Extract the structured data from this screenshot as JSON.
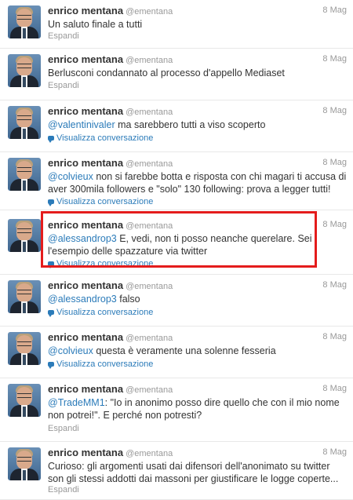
{
  "colors": {
    "mention": "#2b7bb9",
    "muted": "#999999",
    "highlight": "#e41c1c"
  },
  "tweets": [
    {
      "name": "enrico mentana",
      "handle": "@ementana",
      "date": "8 Mag",
      "mention": "",
      "text": "Un saluto finale a tutti",
      "action": "Espandi",
      "action_type": "expand"
    },
    {
      "name": "enrico mentana",
      "handle": "@ementana",
      "date": "8 Mag",
      "mention": "",
      "text": "Berlusconi   condannato al processo d'appello Mediaset",
      "action": "Espandi",
      "action_type": "expand"
    },
    {
      "name": "enrico mentana",
      "handle": "@ementana",
      "date": "8 Mag",
      "mention": "@valentinivaler",
      "text": " ma sarebbero tutti a viso scoperto",
      "action": "Visualizza conversazione",
      "action_type": "conversation"
    },
    {
      "name": "enrico mentana",
      "handle": "@ementana",
      "date": "8 Mag",
      "mention": "@colvieux",
      "text": " non si farebbe botta e risposta con chi magari ti accusa di aver 300mila followers e \"solo\" 130 following: prova a legger tutti!",
      "action": "Visualizza conversazione",
      "action_type": "conversation"
    },
    {
      "name": "enrico mentana",
      "handle": "@ementana",
      "date": "8 Mag",
      "mention": "@alessandrop3",
      "text": " E, vedi, non ti posso neanche querelare. Sei l'esempio delle spazzature via twitter",
      "action": "Visualizza conversazione",
      "action_type": "conversation"
    },
    {
      "name": "enrico mentana",
      "handle": "@ementana",
      "date": "8 Mag",
      "mention": "@alessandrop3",
      "text": " falso",
      "action": "Visualizza conversazione",
      "action_type": "conversation"
    },
    {
      "name": "enrico mentana",
      "handle": "@ementana",
      "date": "8 Mag",
      "mention": "@colvieux",
      "text": " questa è veramente una solenne fesseria",
      "action": "Visualizza conversazione",
      "action_type": "conversation"
    },
    {
      "name": "enrico mentana",
      "handle": "@ementana",
      "date": "8 Mag",
      "mention": "@TradeMM1",
      "text": ": \"Io in anonimo posso dire quello che con il mio nome non potrei!\". E perché non potresti?",
      "action": "Espandi",
      "action_type": "expand"
    },
    {
      "name": "enrico mentana",
      "handle": "@ementana",
      "date": "8 Mag",
      "mention": "",
      "text": "Curioso: gli argomenti usati dai difensori dell'anonimato su twitter son gli stessi addotti dai massoni per giustificare le logge coperte...",
      "action": "Espandi",
      "action_type": "expand"
    }
  ]
}
